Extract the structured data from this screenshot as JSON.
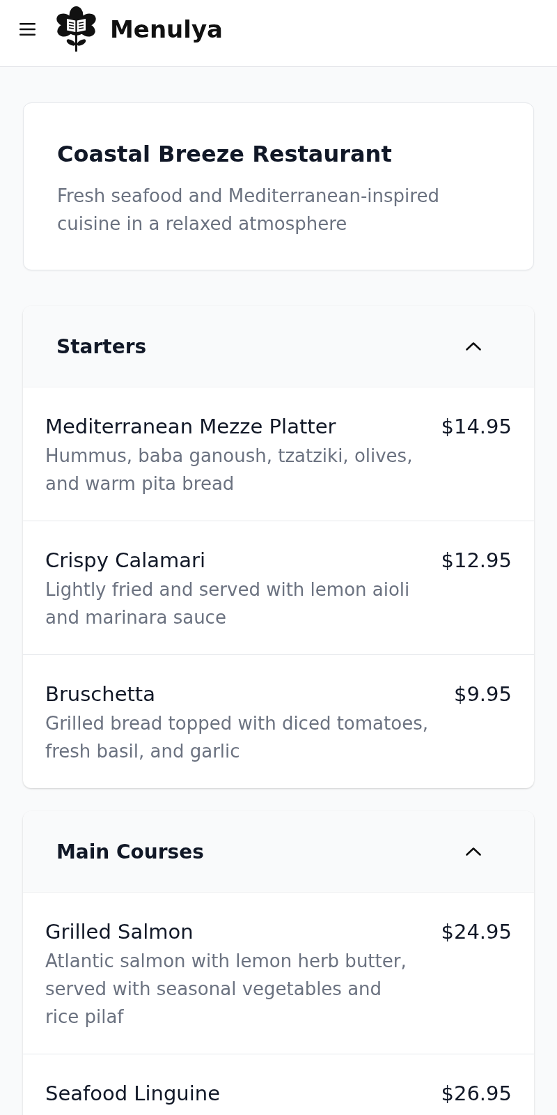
{
  "header": {
    "brand": "Menulya"
  },
  "restaurant": {
    "name": "Coastal Breeze Restaurant",
    "description": "Fresh seafood and Mediterranean-inspired cuisine in a relaxed atmosphere"
  },
  "sections": [
    {
      "title": "Starters",
      "expanded": true,
      "items": [
        {
          "name": "Mediterranean Mezze Platter",
          "price": "$14.95",
          "description": "Hummus, baba ganoush, tzatziki, olives, and warm pita bread"
        },
        {
          "name": "Crispy Calamari",
          "price": "$12.95",
          "description": "Lightly fried and served with lemon aioli and marinara sauce"
        },
        {
          "name": "Bruschetta",
          "price": "$9.95",
          "description": "Grilled bread topped with diced tomatoes, fresh basil, and garlic"
        }
      ]
    },
    {
      "title": "Main Courses",
      "expanded": true,
      "items": [
        {
          "name": "Grilled Salmon",
          "price": "$24.95",
          "description": "Atlantic salmon with lemon herb butter, served with seasonal vegetables and rice pilaf"
        },
        {
          "name": "Seafood Linguine",
          "price": "$26.95"
        }
      ]
    }
  ]
}
